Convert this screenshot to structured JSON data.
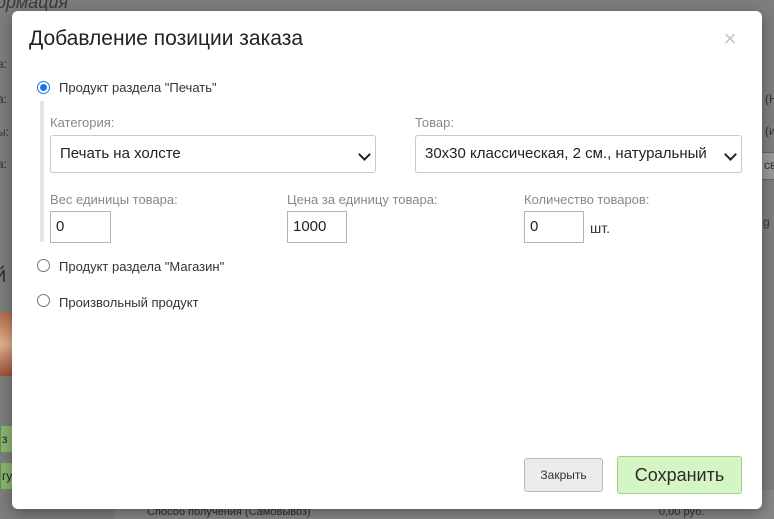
{
  "background": {
    "heading_fragment": "ормация",
    "side_fragments": [
      "а:",
      "а:",
      "ы:",
      "а:"
    ],
    "right_fragments": [
      "(Н",
      "(и",
      "св",
      "g"
    ],
    "big_letter": "й",
    "green_fragments": [
      "з",
      "гу"
    ],
    "footer_left": "Способ получения (Самовывоз)",
    "footer_right": "0,00 руб."
  },
  "modal": {
    "title": "Добавление позиции заказа",
    "close_symbol": "×",
    "options": [
      {
        "label": "Продукт раздела \"Печать\"",
        "checked": true
      },
      {
        "label": "Продукт раздела \"Магазин\"",
        "checked": false
      },
      {
        "label": "Произвольный продукт",
        "checked": false
      }
    ],
    "print_section": {
      "category_label": "Категория:",
      "category_value": "Печать на холсте",
      "product_label": "Товар:",
      "product_value": "30х30 классическая, 2 см., натуральный",
      "weight_label": "Вес единицы товара:",
      "weight_value": "0",
      "price_label": "Цена за единицу товара:",
      "price_value": "1000",
      "qty_label": "Количество товаров:",
      "qty_value": "0",
      "qty_unit": "шт."
    },
    "buttons": {
      "close_label": "Закрыть",
      "save_label": "Сохранить"
    }
  },
  "colors": {
    "overlay": "#7d7d7d",
    "radio_accent": "#1a73e8",
    "save_bg": "#d6f5c4",
    "save_border": "#9ed184"
  }
}
